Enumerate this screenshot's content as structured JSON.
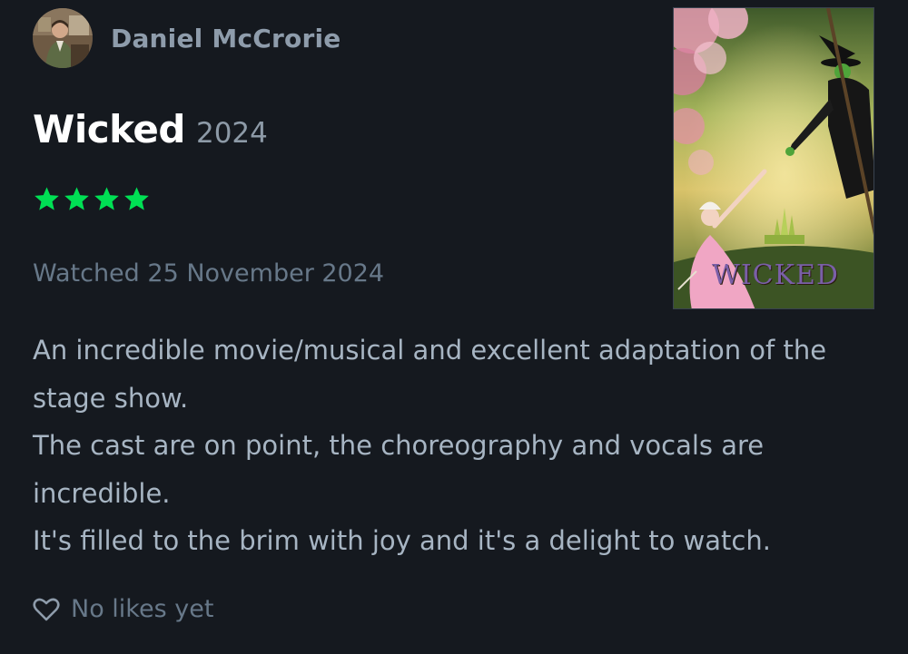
{
  "author": {
    "name": "Daniel McCrorie"
  },
  "film": {
    "title": "Wicked",
    "year": "2024",
    "poster_title": "WICKED"
  },
  "rating": {
    "stars": 4,
    "max_stars": 5
  },
  "watched_label": "Watched 25 November 2024",
  "review": {
    "paragraphs": [
      "An incredible movie/musical and excellent adaptation of the stage show.",
      "The cast are on point, the choreography and vocals are incredible.",
      "It's filled to the brim with joy and it's a delight to watch."
    ]
  },
  "likes": {
    "label": "No likes yet",
    "icon": "heart-outline-icon"
  },
  "colors": {
    "background": "#15191f",
    "star": "#00e054",
    "title": "#ffffff",
    "muted": "#677889",
    "body_text": "#a7b5c3"
  }
}
